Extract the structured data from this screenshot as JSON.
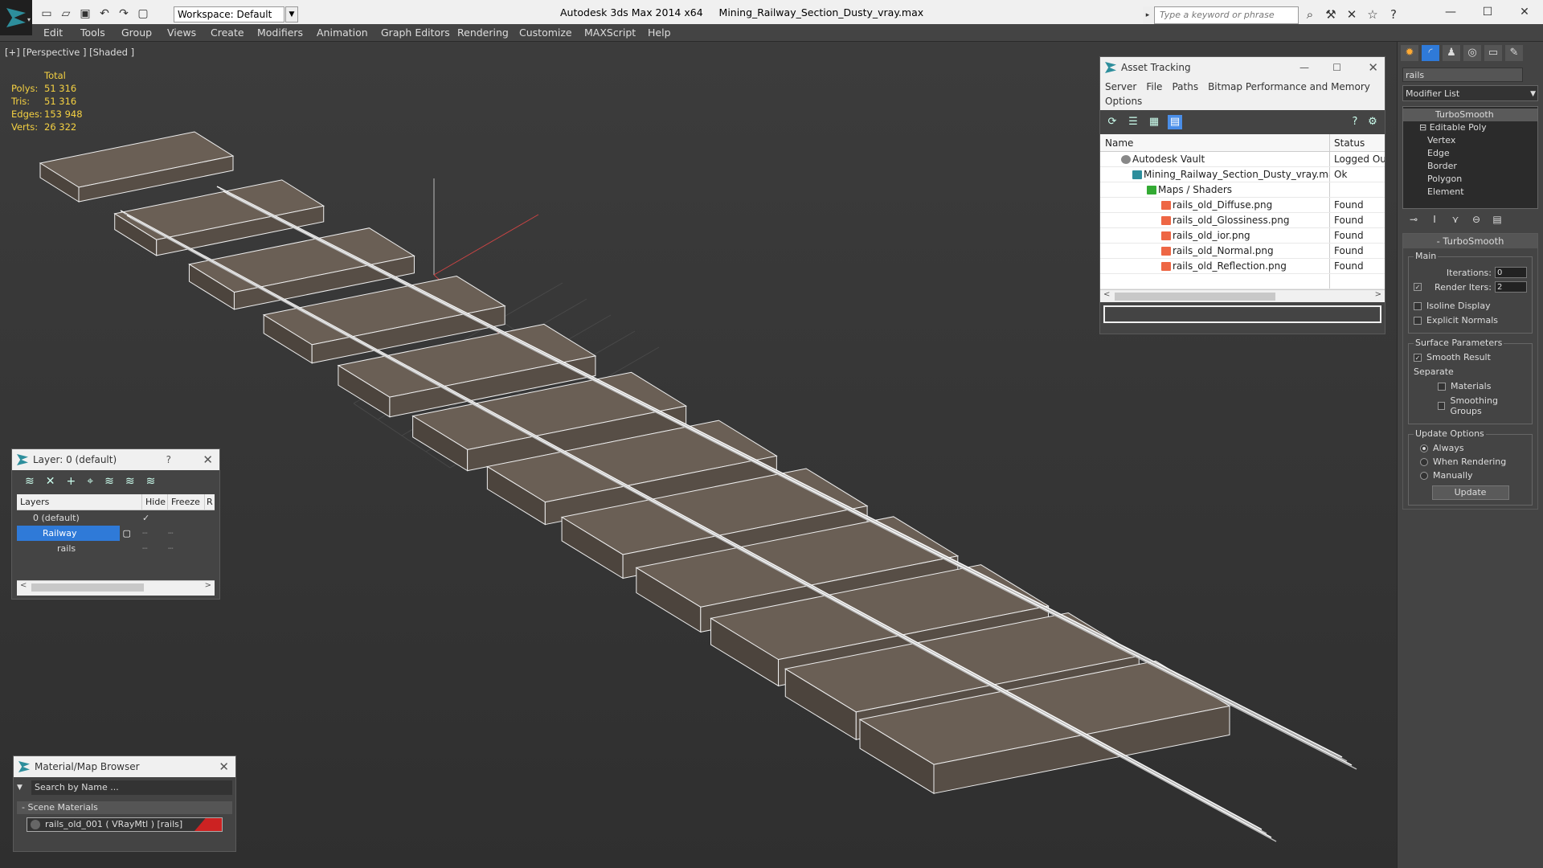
{
  "window": {
    "app_title": "Autodesk 3ds Max  2014 x64",
    "file_title": "Mining_Railway_Section_Dusty_vray.max",
    "workspace": "Workspace: Default",
    "search_placeholder": "Type a keyword or phrase"
  },
  "menu": [
    "Edit",
    "Tools",
    "Group",
    "Views",
    "Create",
    "Modifiers",
    "Animation",
    "Graph Editors",
    "Rendering",
    "Customize",
    "MAXScript",
    "Help"
  ],
  "viewport": {
    "label": "[+] [Perspective ] [Shaded ]"
  },
  "stats": {
    "header": "Total",
    "rows": [
      {
        "k": "Polys:",
        "v": "51 316"
      },
      {
        "k": "Tris:",
        "v": "51 316"
      },
      {
        "k": "Edges:",
        "v": "153 948"
      },
      {
        "k": "Verts:",
        "v": "26 322"
      }
    ]
  },
  "asset_tracking": {
    "title": "Asset Tracking",
    "menu": [
      "Server",
      "File",
      "Paths",
      "Bitmap Performance and Memory"
    ],
    "menu2": "Options",
    "columns": [
      "Name",
      "Status"
    ],
    "rows": [
      {
        "name": "Autodesk Vault",
        "status": "Logged Ou"
      },
      {
        "name": "Mining_Railway_Section_Dusty_vray.max",
        "status": "Ok"
      },
      {
        "name": "Maps / Shaders",
        "status": ""
      },
      {
        "name": "rails_old_Diffuse.png",
        "status": "Found"
      },
      {
        "name": "rails_old_Glossiness.png",
        "status": "Found"
      },
      {
        "name": "rails_old_ior.png",
        "status": "Found"
      },
      {
        "name": "rails_old_Normal.png",
        "status": "Found"
      },
      {
        "name": "rails_old_Reflection.png",
        "status": "Found"
      }
    ]
  },
  "layers": {
    "title": "Layer: 0 (default)",
    "help": "?",
    "columns": [
      "Layers",
      "Hide",
      "Freeze",
      "R"
    ],
    "rows": [
      {
        "name": "0 (default)"
      },
      {
        "name": "Railway"
      },
      {
        "name": "rails"
      }
    ]
  },
  "material_browser": {
    "title": "Material/Map Browser",
    "search": "Search by Name ...",
    "section": "- Scene Materials",
    "item": "rails_old_001  ( VRayMtl )  [rails]"
  },
  "command_panel": {
    "name_field": "rails",
    "modifier_list": "Modifier List",
    "stack": [
      "TurboSmooth",
      "Editable Poly",
      "Vertex",
      "Edge",
      "Border",
      "Polygon",
      "Element"
    ],
    "rollout_title": "TurboSmooth",
    "main_group": "Main",
    "iterations_label": "Iterations:",
    "iterations_value": "0",
    "render_iters_label": "Render Iters:",
    "render_iters_value": "2",
    "isoline": "Isoline Display",
    "explicit": "Explicit Normals",
    "surface_group": "Surface Parameters",
    "smooth_result": "Smooth Result",
    "separate": "Separate",
    "materials": "Materials",
    "smoothing_groups": "Smoothing Groups",
    "update_group": "Update Options",
    "always": "Always",
    "when_rendering": "When Rendering",
    "manually": "Manually",
    "update_btn": "Update"
  }
}
